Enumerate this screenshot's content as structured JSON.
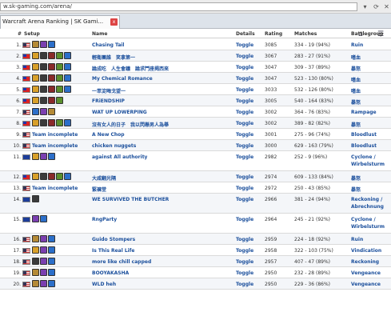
{
  "browser": {
    "url": "w.sk-gaming.com/arena/",
    "tab_title": "Warcraft Arena Ranking | SK Gami...",
    "tab_close": "x",
    "toolbar_home": "⌂",
    "toolbar_rss": "☰"
  },
  "table": {
    "headers": {
      "num": "#",
      "setup": "Setup",
      "name": "Name",
      "details": "Details",
      "rating": "Rating",
      "matches": "Matches",
      "battlegroup": "Battlegroup"
    },
    "team_incomplete_label": "Team incomplete",
    "rows": [
      {
        "rank": "1.",
        "flag": "us",
        "setup": "icons",
        "icons": [
          "#b48a36",
          "#7b3fb0",
          "#2c6fc9"
        ],
        "name": "Chasing Tail",
        "details": "Toggle",
        "rating": "3085",
        "matches": "334 - 19 (94%)",
        "battlegroup": "Ruin"
      },
      {
        "rank": "2.",
        "flag": "tw",
        "setup": "icons",
        "icons": [
          "#d8a02a",
          "#3b3b3b",
          "#8a2a2a",
          "#5a8f2c",
          "#2c6fc9"
        ],
        "name": "輕衛團誰　笑拿第一",
        "details": "Toggle",
        "rating": "3067",
        "matches": "283 - 27 (91%)",
        "battlegroup": "嗜血"
      },
      {
        "rank": "3.",
        "flag": "tw",
        "setup": "icons",
        "icons": [
          "#d8a02a",
          "#3b3b3b",
          "#8a2a2a",
          "#5a8f2c",
          "#2c6fc9"
        ],
        "name": "論成吃　人生會議　論求鬥座揭西來",
        "details": "Toggle",
        "rating": "3047",
        "matches": "309 - 37 (89%)",
        "battlegroup": "暴怒"
      },
      {
        "rank": "4.",
        "flag": "tw",
        "setup": "icons",
        "icons": [
          "#d8a02a",
          "#3b3b3b",
          "#8a2a2a",
          "#5a8f2c",
          "#2c6fc9"
        ],
        "name": "My Chemical Romance",
        "details": "Toggle",
        "rating": "3047",
        "matches": "523 - 130 (80%)",
        "battlegroup": "嗜血"
      },
      {
        "rank": "5.",
        "flag": "tw",
        "setup": "icons",
        "icons": [
          "#d8a02a",
          "#3b3b3b",
          "#8a2a2a",
          "#5a8f2c",
          "#2c6fc9"
        ],
        "name": "一萃淀晦戈望一",
        "details": "Toggle",
        "rating": "3033",
        "matches": "532 - 126 (80%)",
        "battlegroup": "嗜血"
      },
      {
        "rank": "6.",
        "flag": "tw",
        "setup": "icons",
        "icons": [
          "#d8a02a",
          "#3b3b3b",
          "#8a2a2a",
          "#5a8f2c"
        ],
        "name": "FRiENDSHIP",
        "details": "Toggle",
        "rating": "3005",
        "matches": "540 - 164 (83%)",
        "battlegroup": "暴怒"
      },
      {
        "rank": "7.",
        "flag": "us",
        "setup": "icons",
        "icons": [
          "#2c6fc9",
          "#7b3fb0",
          "#b48a36"
        ],
        "name": "WAT UP LOWERPING",
        "details": "Toggle",
        "rating": "3002",
        "matches": "364 - 76 (83%)",
        "battlegroup": "Rampage"
      },
      {
        "rank": "8.",
        "flag": "tw",
        "setup": "icons",
        "icons": [
          "#d8a02a",
          "#3b3b3b",
          "#8a2a2a",
          "#5a8f2c",
          "#2c6fc9"
        ],
        "name": "沒有女人的日子　我以閃懸男人為舉",
        "details": "Toggle",
        "rating": "3002",
        "matches": "389 - 82 (82%)",
        "battlegroup": "暴怒"
      },
      {
        "rank": "9.",
        "flag": "us",
        "setup": "incomplete",
        "icons": [],
        "name": "A New Chop",
        "details": "Toggle",
        "rating": "3001",
        "matches": "275 - 96 (74%)",
        "battlegroup": "Bloodlust"
      },
      {
        "rank": "10.",
        "flag": "us",
        "setup": "incomplete",
        "icons": [],
        "name": "chicken nuggets",
        "details": "Toggle",
        "rating": "3000",
        "matches": "629 - 163 (79%)",
        "battlegroup": "Bloodlust"
      },
      {
        "rank": "11.",
        "flag": "eu",
        "setup": "icons",
        "icons": [
          "#d8a02a",
          "#7b3fb0",
          "#2c6fc9"
        ],
        "name": "against All authority",
        "details": "Toggle",
        "rating": "2982",
        "matches": "252 - 9 (96%)",
        "battlegroup": "Cyclone /",
        "battlegroup2": "Wirbelsturm"
      },
      {
        "rank": "12.",
        "flag": "tw",
        "setup": "icons",
        "icons": [
          "#d8a02a",
          "#3b3b3b",
          "#8a2a2a",
          "#5a8f2c",
          "#2c6fc9"
        ],
        "name": "大咸翻光隔",
        "details": "Toggle",
        "rating": "2974",
        "matches": "609 - 133 (84%)",
        "battlegroup": "暴怒"
      },
      {
        "rank": "13.",
        "flag": "us",
        "setup": "incomplete",
        "icons": [],
        "name": "緊褲堂",
        "details": "Toggle",
        "rating": "2972",
        "matches": "250 - 43 (85%)",
        "battlegroup": "暴怒"
      },
      {
        "rank": "14.",
        "flag": "eu",
        "setup": "icons",
        "icons": [
          "#3b3b3b"
        ],
        "name": "WE SURVIVED THE BUTCHER",
        "details": "Toggle",
        "rating": "2966",
        "matches": "381 - 24 (94%)",
        "battlegroup": "Reckoning /",
        "battlegroup2": "Abrechnung"
      },
      {
        "rank": "15.",
        "flag": "eu",
        "setup": "icons",
        "icons": [
          "#7b3fb0",
          "#2c6fc9"
        ],
        "name": "RngParty",
        "details": "Toggle",
        "rating": "2964",
        "matches": "245 - 21 (92%)",
        "battlegroup": "Cyclone /",
        "battlegroup2": "Wirbelsturm"
      },
      {
        "rank": "16.",
        "flag": "us",
        "setup": "icons",
        "icons": [
          "#b48a36",
          "#7b3fb0",
          "#2c6fc9"
        ],
        "name": "Guido Stompers",
        "details": "Toggle",
        "rating": "2959",
        "matches": "224 - 18 (92%)",
        "battlegroup": "Ruin"
      },
      {
        "rank": "17.",
        "flag": "us",
        "setup": "icons",
        "icons": [
          "#d8a02a",
          "#7b3fb0",
          "#2c6fc9"
        ],
        "name": "Is This Real Life",
        "details": "Toggle",
        "rating": "2958",
        "matches": "322 - 103 (75%)",
        "battlegroup": "Vindication"
      },
      {
        "rank": "18.",
        "flag": "us",
        "setup": "icons",
        "icons": [
          "#3b3b3b",
          "#7b3fb0",
          "#2c6fc9"
        ],
        "name": "more like chill capped",
        "details": "Toggle",
        "rating": "2957",
        "matches": "407 - 47 (89%)",
        "battlegroup": "Reckoning"
      },
      {
        "rank": "19.",
        "flag": "us",
        "setup": "icons",
        "icons": [
          "#b48a36",
          "#7b3fb0",
          "#2c6fc9"
        ],
        "name": "BOOYAKASHA",
        "details": "Toggle",
        "rating": "2950",
        "matches": "232 - 28 (89%)",
        "battlegroup": "Vengeance"
      },
      {
        "rank": "20.",
        "flag": "us",
        "setup": "icons",
        "icons": [
          "#b48a36",
          "#7b3fb0",
          "#2c6fc9"
        ],
        "name": "WLD heh",
        "details": "Toggle",
        "rating": "2950",
        "matches": "229 - 36 (86%)",
        "battlegroup": "Vengeance"
      }
    ]
  }
}
